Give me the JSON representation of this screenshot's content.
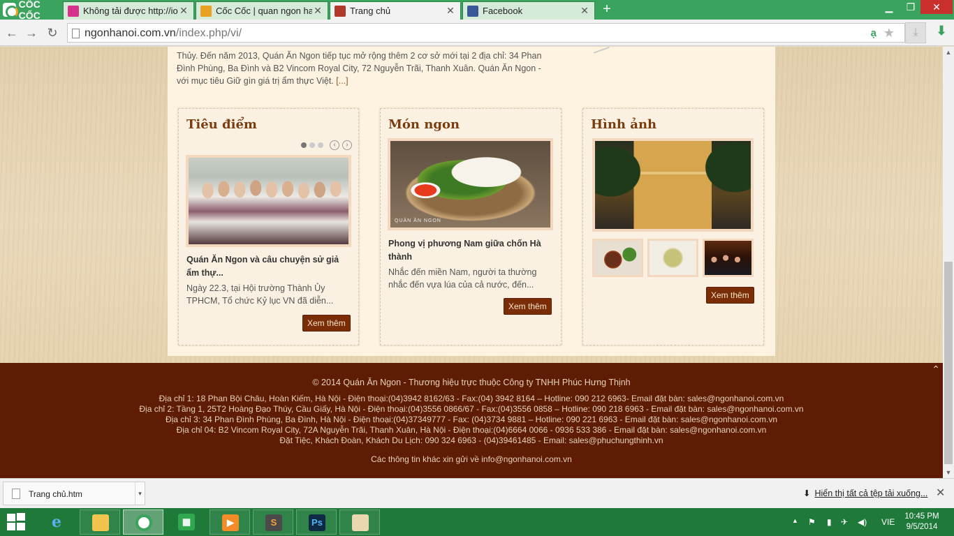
{
  "browser": {
    "logo_text": "CỐC CỐC",
    "tabs": [
      {
        "title": "Không tải được http://ion",
        "favicon_color": "#d6338a"
      },
      {
        "title": "Cốc Cốc | quan ngon ha n",
        "favicon_color": "#e9a21f"
      },
      {
        "title": "Trang chủ",
        "favicon_color": "#b03a2a",
        "active": true
      },
      {
        "title": "Facebook",
        "favicon_color": "#3b5998"
      }
    ],
    "url_domain": "ngonhanoi.com.vn",
    "url_path": "/index.php/vi/"
  },
  "page": {
    "intro_text": "Thủy. Đến năm 2013, Quán Ăn Ngon tiếp tục mở rộng thêm 2 cơ sở mới tại 2 địa chỉ: 34 Phan Đình Phùng, Ba Đình và B2 Vincom Royal City, 72 Nguyễn Trãi, Thanh Xuân. Quán Ăn Ngon - với mục tiêu Giữ gìn giá trị ẩm thực Việt.",
    "intro_more": "[...]",
    "cards": [
      {
        "heading": "Tiêu điểm",
        "item_title": "Quán Ăn Ngon và câu chuyện sử giả ẩm thự...",
        "item_desc": "Ngày 22.3, tại Hội trường Thành Ủy TPHCM, Tổ chức Kỷ lục VN đã diễn...",
        "button": "Xem thêm"
      },
      {
        "heading": "Món ngon",
        "photo_caption": "QUÁN ĂN NGON",
        "item_title": "Phong vị phương Nam giữa chốn Hà thành",
        "item_desc": "Nhắc đến miền Nam, người ta thường nhắc đến vựa lúa của cả nước, đến...",
        "button": "Xem thêm"
      },
      {
        "heading": "Hình ảnh",
        "button": "Xem thêm"
      }
    ],
    "slider": {
      "dot_count": 3,
      "active_index": 0
    }
  },
  "footer": {
    "copyright": "© 2014 Quán Ăn Ngon - Thương hiệu trực thuộc Công ty TNHH Phúc Hưng Thịnh",
    "addresses": [
      "Địa chỉ 1: 18 Phan Bội Châu, Hoàn Kiếm, Hà Nội - Điện thoại:(04)3942 8162/63 - Fax:(04) 3942 8164 – Hotline: 090 212 6963- Email đặt bàn:  sales@ngonhanoi.com.vn",
      "Địa chỉ 2: Tầng 1, 25T2 Hoàng Đạo Thúy, Cầu Giấy, Hà Nội - Điện thoại:(04)3556 0866/67 - Fax:(04)3556 0858 – Hotline: 090 218 6963 - Email đặt bàn:  sales@ngonhanoi.com.vn",
      "Địa chỉ 3: 34 Phan Đình Phùng, Ba Đình, Hà Nội - Điện thoại:(04)37349777 - Fax: (04)3734 9881 – Hotline: 090 221 6963 - Email đặt bàn:  sales@ngonhanoi.com.vn",
      "Địa chỉ 04: B2 Vincom Royal City, 72A Nguyễn Trãi, Thanh Xuân, Hà Nội - Điện thoại:(04)6664 0066 - 0936 533 386 - Email đặt bàn:  sales@ngonhanoi.com.vn",
      "Đặt Tiệc, Khách Đoàn, Khách Du Lịch: 090 324 6963 - (04)39461485 - Email:  sales@phuchungthinh.vn"
    ],
    "contact": "Các thông tin khác xin gửi về info@ngonhanoi.com.vn"
  },
  "downloads": {
    "file_name": "Trang chủ.htm",
    "show_all": "Hiển thị tất cả tệp tải xuống..."
  },
  "taskbar": {
    "language": "VIE",
    "time": "10:45 PM",
    "date": "9/5/2014"
  }
}
